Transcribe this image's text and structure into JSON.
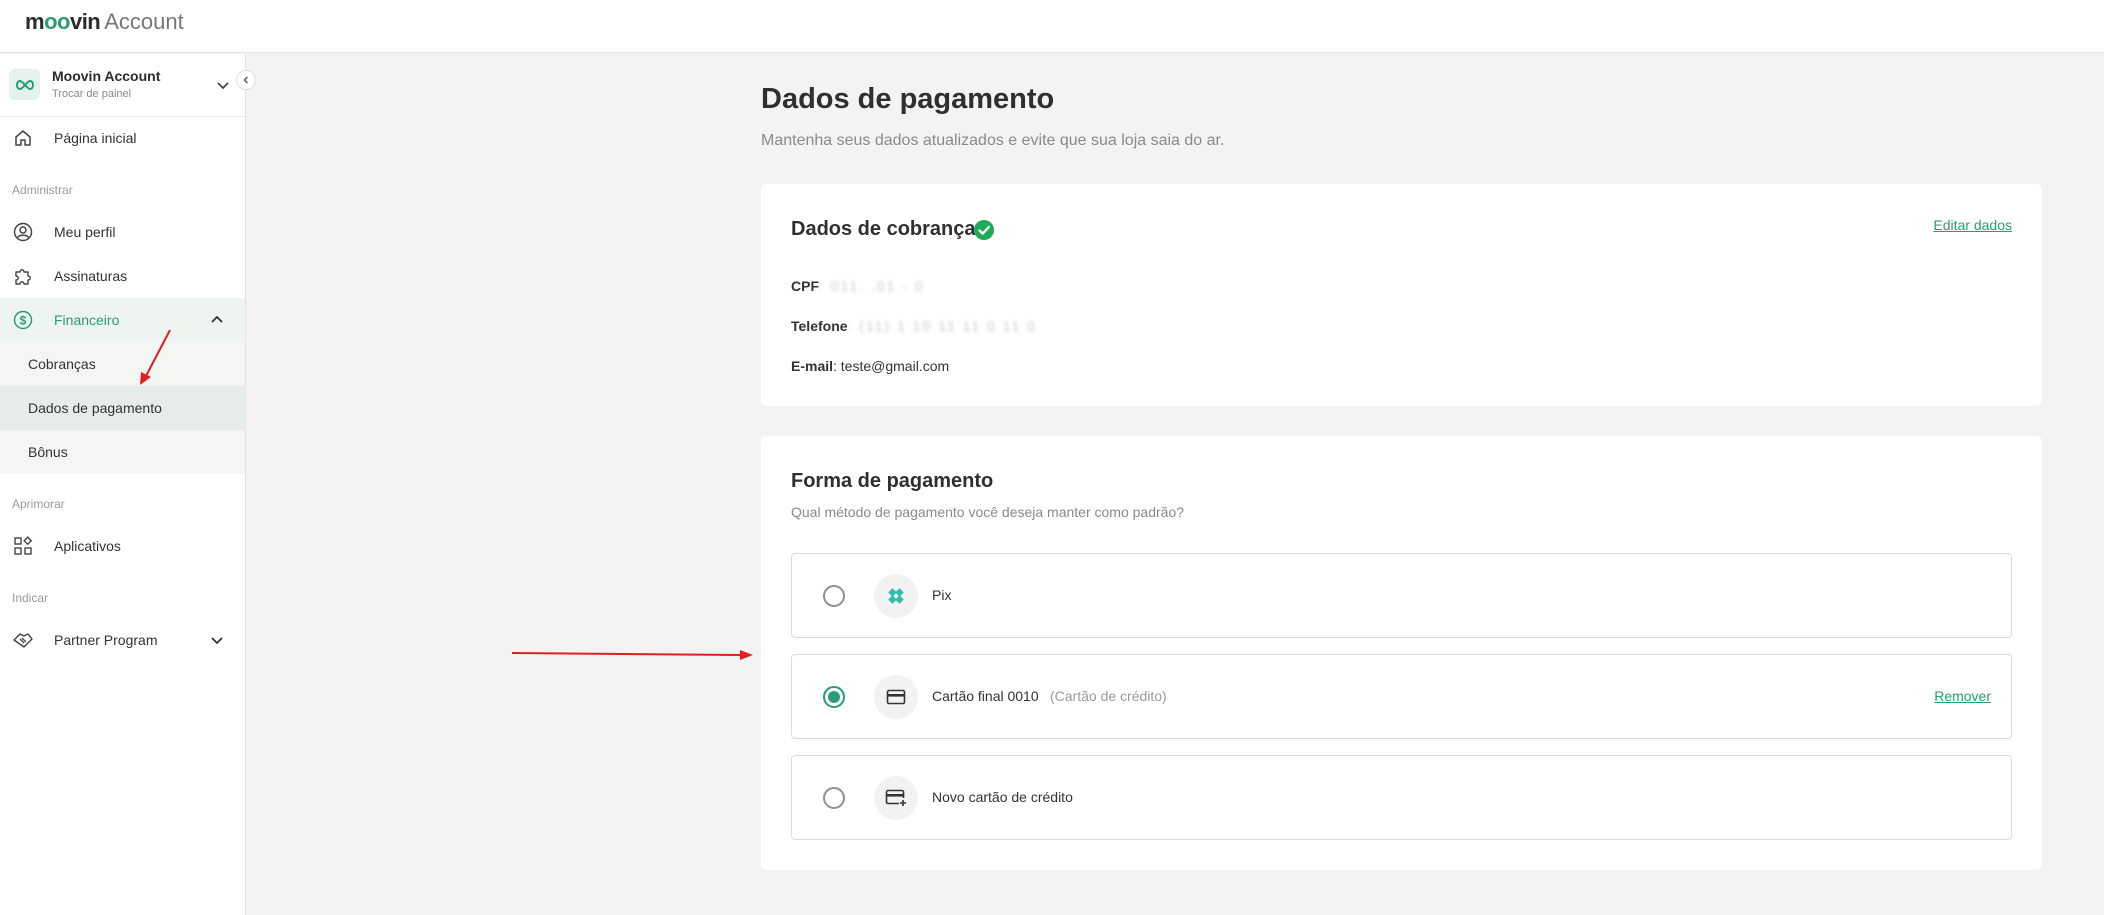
{
  "header": {
    "logo_brand": "moovin",
    "logo_product": "Account"
  },
  "sidebar": {
    "account": {
      "name": "Moovin Account",
      "switch_label": "Trocar de painel"
    },
    "home_label": "Página inicial",
    "sections": {
      "admin": "Administrar",
      "improve": "Aprimorar",
      "refer": "Indicar"
    },
    "items": {
      "profile": "Meu perfil",
      "subscriptions": "Assinaturas",
      "finance": "Financeiro",
      "charges": "Cobranças",
      "payment_data": "Dados de pagamento",
      "bonus": "Bônus",
      "apps": "Aplicativos",
      "partner": "Partner Program"
    }
  },
  "page": {
    "title": "Dados de pagamento",
    "subtitle": "Mantenha seus dados atualizados e evite que sua loja saia do ar."
  },
  "billing": {
    "title": "Dados de cobrança",
    "edit_label": "Editar dados",
    "cpf_label": "CPF",
    "cpf_value": ": 011.     .01 - 0",
    "phone_label": "Telefone",
    "phone_value": ": (11) 1 10 11 11 0 11 0",
    "email_label": "E-mail",
    "email_value": ": teste@gmail.com"
  },
  "payment": {
    "title": "Forma de pagamento",
    "subtitle": "Qual método de pagamento você deseja manter como padrão?",
    "options": [
      {
        "label": "Pix",
        "icon": "pix-icon",
        "selected": false
      },
      {
        "label": "Cartão final 0010",
        "note": "(Cartão de crédito)",
        "icon": "credit-card-icon",
        "selected": true,
        "action": "Remover"
      },
      {
        "label": "Novo cartão de crédito",
        "icon": "add-card-icon",
        "selected": false
      }
    ]
  },
  "colors": {
    "accent": "#2a9d73",
    "annotation": "#e02020"
  }
}
